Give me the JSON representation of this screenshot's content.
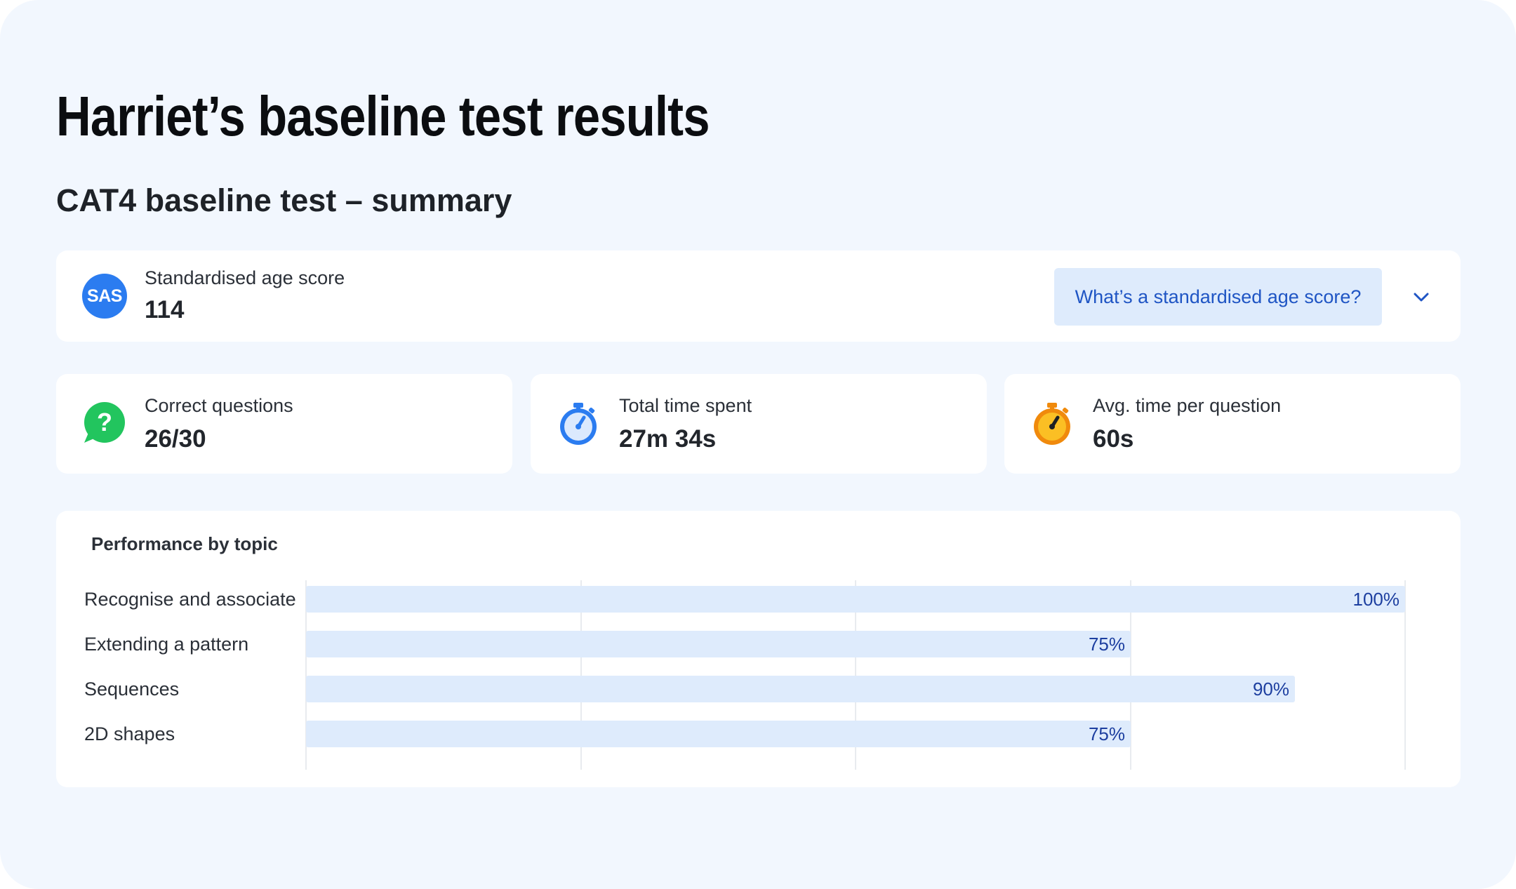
{
  "page": {
    "title": "Harriet’s baseline test results",
    "section_title": "CAT4 baseline test – summary"
  },
  "sas": {
    "badge": "SAS",
    "label": "Standardised age score",
    "value": "114",
    "help_button": "What’s a standardised age score?"
  },
  "stats": [
    {
      "label": "Correct questions",
      "value": "26/30",
      "icon": "speech-question-icon",
      "color": "#22c55e"
    },
    {
      "label": "Total time spent",
      "value": "27m 34s",
      "icon": "stopwatch-icon",
      "color": "#2b7cf0"
    },
    {
      "label": "Avg. time per question",
      "value": "60s",
      "icon": "stopwatch-icon",
      "color": "#f59e0b"
    }
  ],
  "performance": {
    "title": "Performance by topic"
  },
  "chart_data": {
    "type": "bar",
    "orientation": "horizontal",
    "categories": [
      "Recognise and associate",
      "Extending a pattern",
      "Sequences",
      "2D shapes"
    ],
    "values": [
      100,
      75,
      90,
      75
    ],
    "value_labels": [
      "100%",
      "75%",
      "90%",
      "75%"
    ],
    "xlim": [
      0,
      100
    ],
    "grid": true
  },
  "colors": {
    "accent": "#2b7cf0",
    "bar_fill": "#deebfc",
    "bar_label": "#1d3fa0",
    "panel_bg": "#f2f7fe"
  }
}
